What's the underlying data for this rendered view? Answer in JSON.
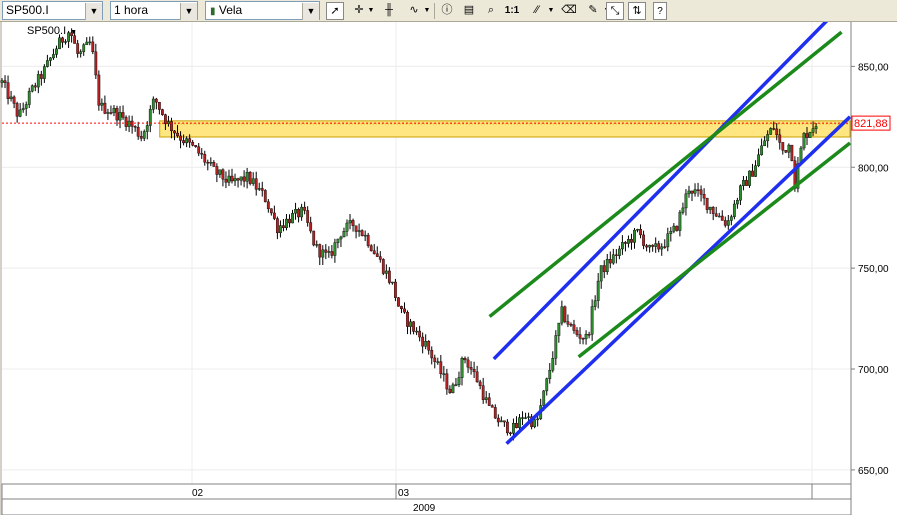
{
  "toolbar": {
    "symbol": "SP500.I",
    "timeframe": "1 hora",
    "chart_style": "Vela",
    "ratio_label": "1:1"
  },
  "chart_data": {
    "type": "candlestick",
    "symbol_label": "SP500.I",
    "x_axis": {
      "tick_labels": [
        "02",
        "03"
      ],
      "period_label": "2009"
    },
    "y_axis": {
      "ticks": [
        "850,00",
        "800,00",
        "750,00",
        "700,00",
        "650,00"
      ],
      "tick_values": [
        850,
        800,
        750,
        700,
        650
      ],
      "ylim": [
        643,
        872
      ],
      "side": "right"
    },
    "current_price": {
      "label": "821,88",
      "value": 821.88,
      "color": "#ff0000"
    },
    "resistance_zone": {
      "low": 815,
      "high": 823,
      "color": "#ffe680",
      "border_color": "#c8a000"
    },
    "price_path": [
      [
        0,
        842
      ],
      [
        0.02,
        825
      ],
      [
        0.035,
        838
      ],
      [
        0.05,
        848
      ],
      [
        0.065,
        860
      ],
      [
        0.08,
        868
      ],
      [
        0.09,
        855
      ],
      [
        0.105,
        862
      ],
      [
        0.115,
        830
      ],
      [
        0.13,
        828
      ],
      [
        0.15,
        822
      ],
      [
        0.165,
        815
      ],
      [
        0.18,
        834
      ],
      [
        0.195,
        822
      ],
      [
        0.21,
        815
      ],
      [
        0.23,
        808
      ],
      [
        0.25,
        798
      ],
      [
        0.27,
        792
      ],
      [
        0.29,
        795
      ],
      [
        0.31,
        785
      ],
      [
        0.325,
        770
      ],
      [
        0.34,
        775
      ],
      [
        0.355,
        778
      ],
      [
        0.37,
        760
      ],
      [
        0.385,
        755
      ],
      [
        0.4,
        768
      ],
      [
        0.415,
        772
      ],
      [
        0.43,
        765
      ],
      [
        0.445,
        754
      ],
      [
        0.46,
        742
      ],
      [
        0.47,
        728
      ],
      [
        0.485,
        720
      ],
      [
        0.5,
        712
      ],
      [
        0.515,
        700
      ],
      [
        0.53,
        688
      ],
      [
        0.545,
        706
      ],
      [
        0.56,
        695
      ],
      [
        0.575,
        680
      ],
      [
        0.59,
        672
      ],
      [
        0.605,
        670
      ],
      [
        0.615,
        678
      ],
      [
        0.63,
        672
      ],
      [
        0.645,
        698
      ],
      [
        0.66,
        728
      ],
      [
        0.675,
        718
      ],
      [
        0.69,
        715
      ],
      [
        0.705,
        748
      ],
      [
        0.72,
        755
      ],
      [
        0.735,
        762
      ],
      [
        0.75,
        768
      ],
      [
        0.765,
        758
      ],
      [
        0.78,
        762
      ],
      [
        0.795,
        770
      ],
      [
        0.81,
        790
      ],
      [
        0.825,
        785
      ],
      [
        0.84,
        778
      ],
      [
        0.855,
        772
      ],
      [
        0.87,
        788
      ],
      [
        0.885,
        798
      ],
      [
        0.9,
        814
      ],
      [
        0.91,
        820
      ],
      [
        0.92,
        808
      ],
      [
        0.93,
        812
      ],
      [
        0.935,
        792
      ],
      [
        0.945,
        815
      ],
      [
        0.96,
        822
      ]
    ],
    "trend_lines": [
      {
        "color": "#1f2ff0",
        "from": [
          0.595,
          663
        ],
        "to": [
          1.0,
          825
        ]
      },
      {
        "color": "#1f2ff0",
        "from": [
          0.58,
          705
        ],
        "to": [
          0.99,
          880
        ]
      },
      {
        "color": "#1b8a1b",
        "from": [
          0.575,
          726
        ],
        "to": [
          0.99,
          867
        ]
      },
      {
        "color": "#1b8a1b",
        "from": [
          0.68,
          706
        ],
        "to": [
          1.0,
          812
        ]
      }
    ]
  }
}
